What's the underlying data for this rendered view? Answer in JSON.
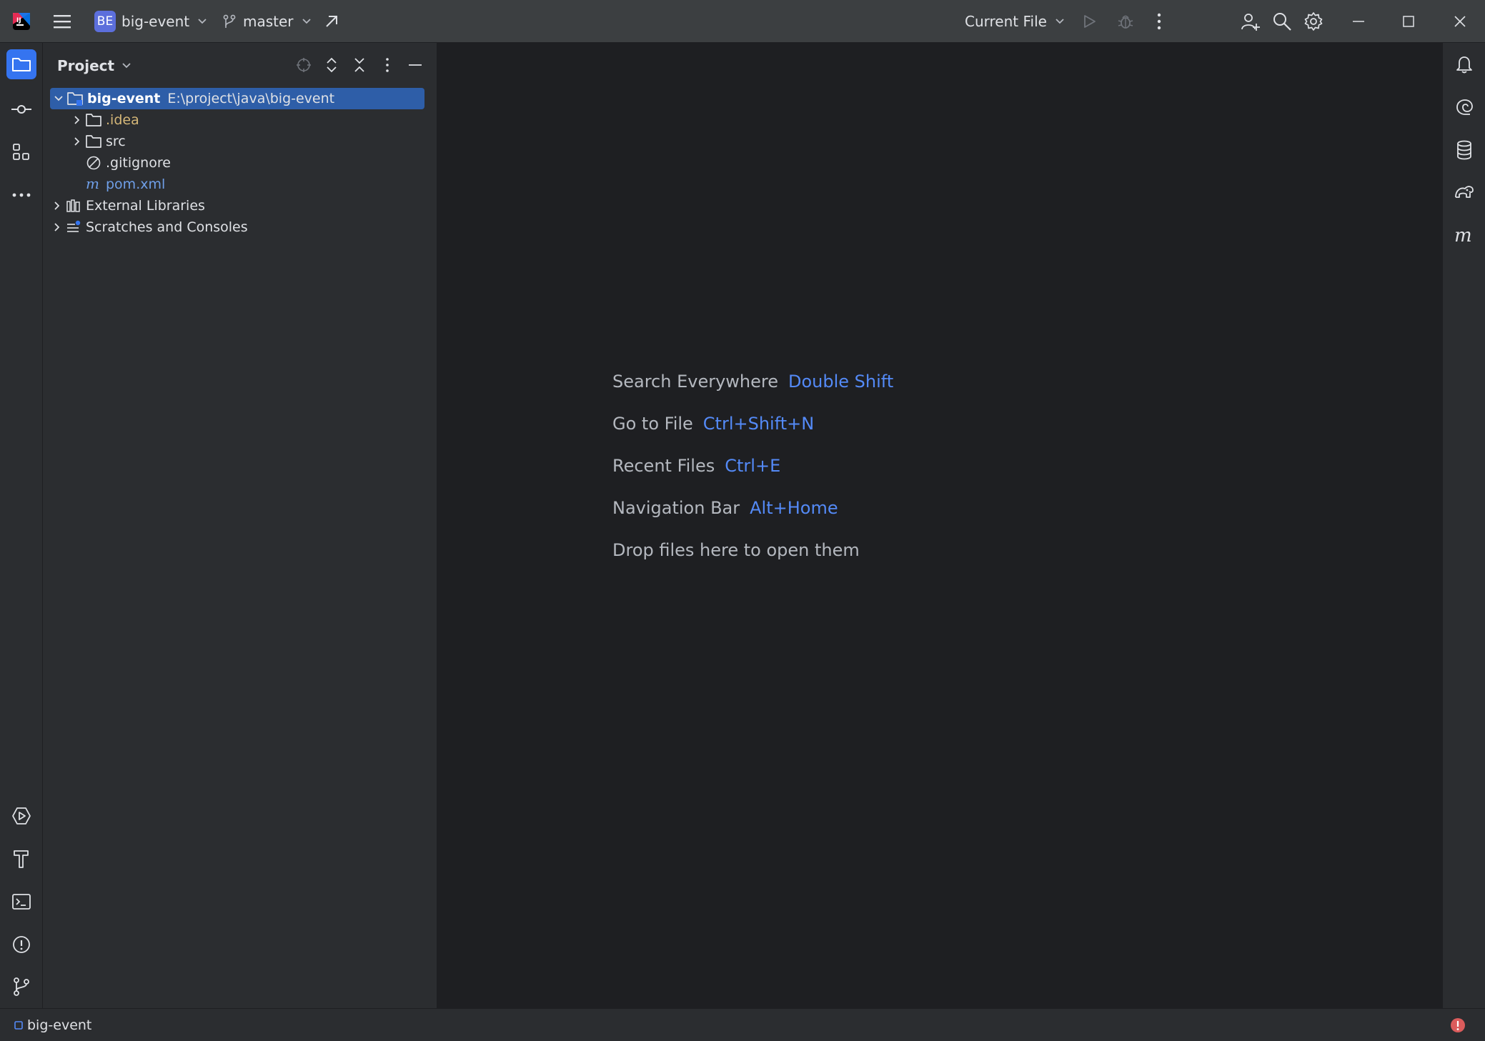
{
  "titlebar": {
    "project_badge": "BE",
    "project_name": "big-event",
    "branch": "master",
    "run_config": "Current File"
  },
  "left_strip": {
    "top_tools": [
      "folder-icon",
      "commit-icon",
      "structure-icon",
      "more-icon"
    ],
    "bottom_tools": [
      "services-icon",
      "build-icon",
      "terminal-icon",
      "problems-icon",
      "git-icon"
    ]
  },
  "project_panel": {
    "title": "Project",
    "tree": [
      {
        "name": "big-event",
        "path": "E:\\project\\java\\big-event",
        "type": "module",
        "expanded": true,
        "selected": true
      },
      {
        "name": ".idea",
        "type": "folder",
        "color": "#d5b778"
      },
      {
        "name": "src",
        "type": "folder"
      },
      {
        "name": ".gitignore",
        "type": "ignore-file"
      },
      {
        "name": "pom.xml",
        "type": "maven-file",
        "color": "#6f9fe8"
      },
      {
        "name": "External Libraries",
        "type": "libraries"
      },
      {
        "name": "Scratches and Consoles",
        "type": "scratches"
      }
    ]
  },
  "editor": {
    "hints": [
      {
        "label": "Search Everywhere",
        "key": "Double Shift"
      },
      {
        "label": "Go to File",
        "key": "Ctrl+Shift+N"
      },
      {
        "label": "Recent Files",
        "key": "Ctrl+E"
      },
      {
        "label": "Navigation Bar",
        "key": "Alt+Home"
      }
    ],
    "drop_text": "Drop files here to open them"
  },
  "right_strip": [
    "notifications-icon",
    "ai-assistant-icon",
    "database-icon",
    "gradle-icon",
    "maven-icon"
  ],
  "statusbar": {
    "project": "big-event"
  },
  "colors": {
    "accent": "#3574f0",
    "selection": "#2e5ea8",
    "shortcut": "#548af7",
    "error": "#db5c5c"
  }
}
